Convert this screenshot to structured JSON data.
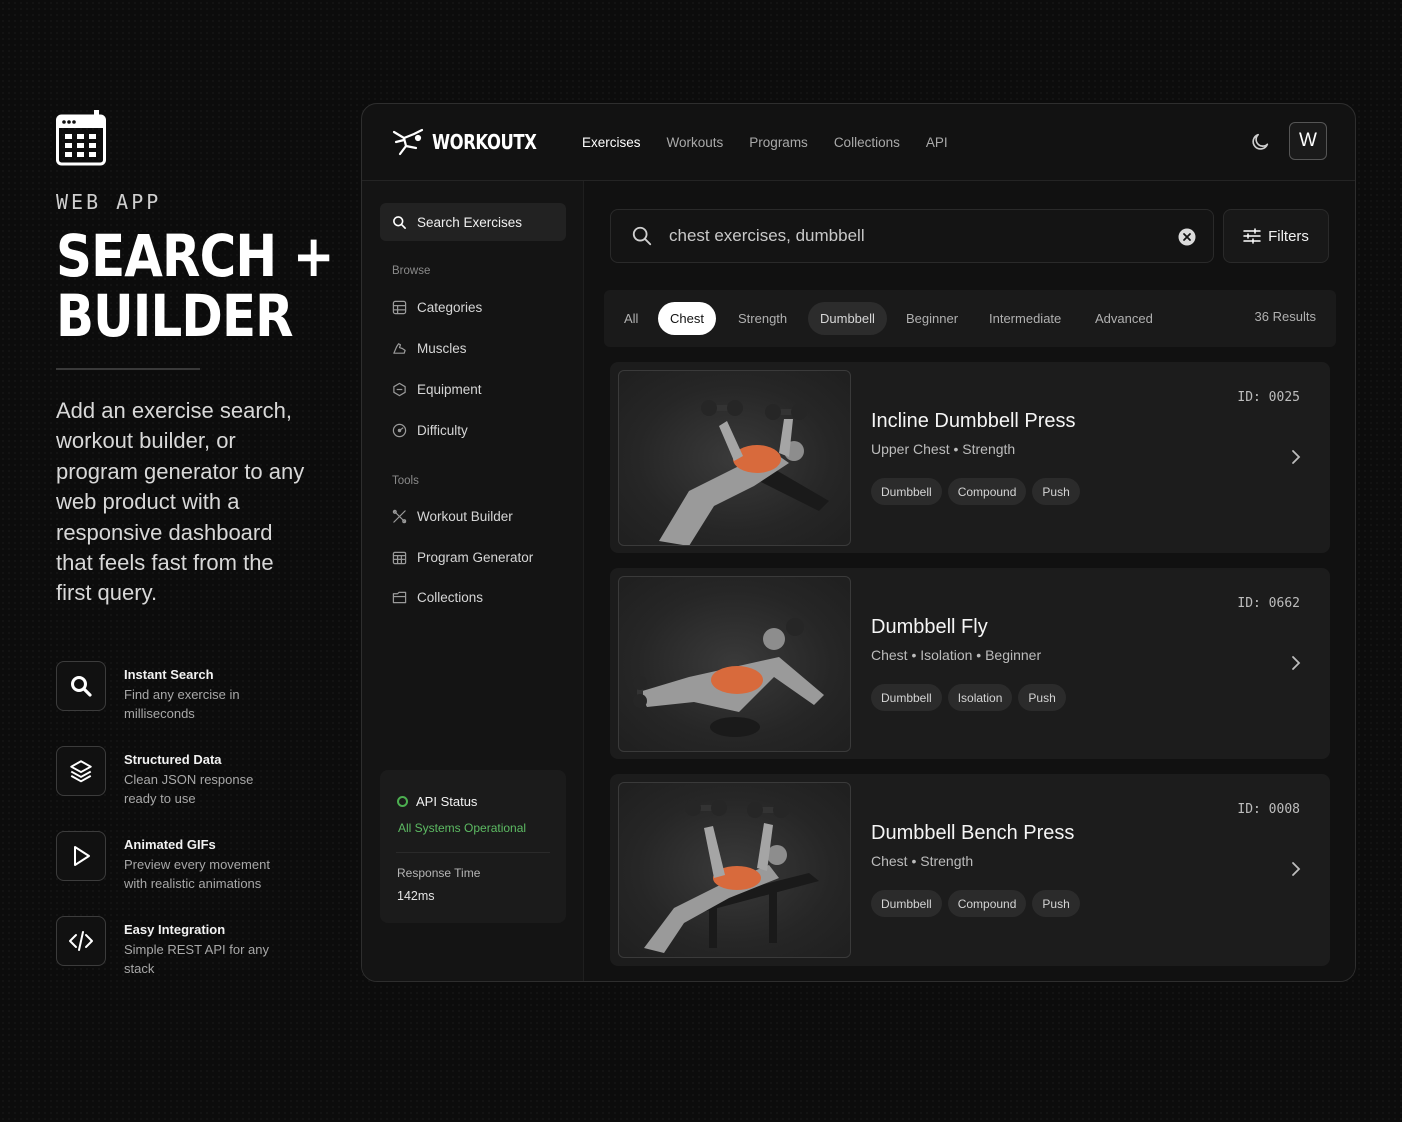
{
  "marketing": {
    "eyebrow": "WEB APP",
    "hero_line1": "SEARCH +",
    "hero_line2": "BUILDER",
    "description": "Add an exercise search, workout builder, or program generator to any web product with a responsive dashboard that feels fast from the first query.",
    "features": [
      {
        "icon": "search-icon",
        "title": "Instant Search",
        "desc": "Find any exercise in milliseconds"
      },
      {
        "icon": "layers-icon",
        "title": "Structured Data",
        "desc": "Clean JSON response ready to use"
      },
      {
        "icon": "play-icon",
        "title": "Animated GIFs",
        "desc": "Preview every movement with realistic animations"
      },
      {
        "icon": "code-icon",
        "title": "Easy Integration",
        "desc": "Simple REST API for any stack"
      }
    ]
  },
  "app": {
    "brand": "WORKOUTX",
    "nav": [
      {
        "label": "Exercises",
        "active": true
      },
      {
        "label": "Workouts",
        "active": false
      },
      {
        "label": "Programs",
        "active": false
      },
      {
        "label": "Collections",
        "active": false
      },
      {
        "label": "API",
        "active": false
      }
    ],
    "avatar_letter": "W",
    "sidebar": {
      "search_label": "Search Exercises",
      "browse_heading": "Browse",
      "browse_items": [
        "Categories",
        "Muscles",
        "Equipment",
        "Difficulty"
      ],
      "tools_heading": "Tools",
      "tools_items": [
        "Workout Builder",
        "Program Generator",
        "Collections"
      ],
      "status": {
        "title": "API Status",
        "subtitle": "All Systems Operational",
        "response_label": "Response Time",
        "response_value": "142ms",
        "color": "#4caf50"
      }
    },
    "search": {
      "value": "chest exercises, dumbbell"
    },
    "filters_label": "Filters",
    "chips": [
      {
        "label": "All",
        "state": "plain"
      },
      {
        "label": "Chest",
        "state": "selected"
      },
      {
        "label": "Strength",
        "state": "plain"
      },
      {
        "label": "Dumbbell",
        "state": "active"
      },
      {
        "label": "Beginner",
        "state": "plain"
      },
      {
        "label": "Intermediate",
        "state": "plain"
      },
      {
        "label": "Advanced",
        "state": "plain"
      }
    ],
    "results_count": "36",
    "results_label": "Results",
    "exercises": [
      {
        "id": "ID: 0025",
        "title": "Incline Dumbbell Press",
        "subtitle": "Upper Chest • Strength",
        "tags": [
          "Dumbbell",
          "Compound",
          "Push"
        ]
      },
      {
        "id": "ID: 0662",
        "title": "Dumbbell Fly",
        "subtitle": "Chest • Isolation • Beginner",
        "tags": [
          "Dumbbell",
          "Isolation",
          "Push"
        ]
      },
      {
        "id": "ID: 0008",
        "title": "Dumbbell Bench Press",
        "subtitle": "Chest • Strength",
        "tags": [
          "Dumbbell",
          "Compound",
          "Push"
        ]
      }
    ]
  }
}
